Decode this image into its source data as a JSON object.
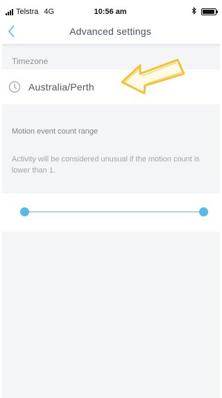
{
  "status_bar": {
    "carrier": "Telstra",
    "network": "4G",
    "time": "10:56 am",
    "battery_level": 0.95,
    "bluetooth_icon": "bluetooth-icon",
    "signal_bars": 4
  },
  "nav": {
    "back_icon": "chevron-left-icon",
    "title": "Advanced settings"
  },
  "timezone": {
    "label": "Timezone",
    "icon": "clock-icon",
    "value": "Australia/Perth"
  },
  "motion": {
    "title": "Motion event count range",
    "description": "Activity will be considered unusual if the motion count is lower than 1.",
    "slider_min_fraction": 0,
    "slider_max_fraction": 1
  },
  "annotation": {
    "arrow_color": "#f2c230",
    "points_to": "timezone"
  },
  "colors": {
    "accent": "#59b9e9",
    "background": "#f4f5f7"
  }
}
